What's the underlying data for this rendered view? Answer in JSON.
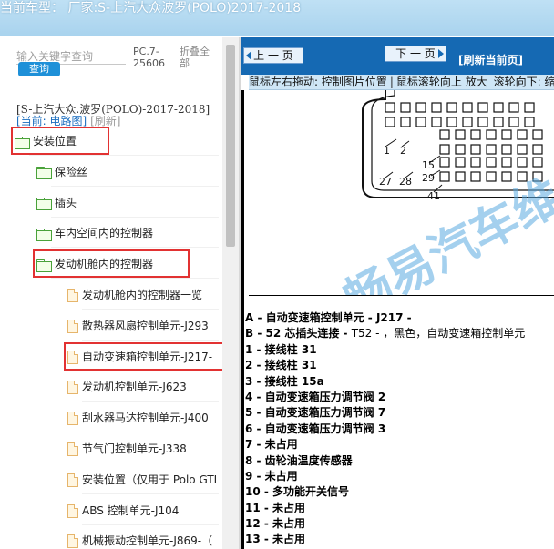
{
  "titlebar": {
    "text": "当前车型：  厂家:S-上汽大众波罗(POLO)2017-2018"
  },
  "left": {
    "search_placeholder": "输入关键字查询",
    "query_label": "查询",
    "pc_label": "PC.7-25606",
    "collapse_label": "折叠全部",
    "car_model": "[S-上汽大众.波罗(POLO)-2017-2018]",
    "current_prefix": "[当前: 电路图]",
    "refresh_label": "[刷新]",
    "tree": [
      {
        "label": "安装位置",
        "type": "folder",
        "level": 0,
        "highlighted": true
      },
      {
        "label": "保险丝",
        "type": "folder",
        "level": 1,
        "highlighted": false
      },
      {
        "label": "插头",
        "type": "folder",
        "level": 1,
        "highlighted": false
      },
      {
        "label": "车内空间内的控制器",
        "type": "folder",
        "level": 1,
        "highlighted": false
      },
      {
        "label": "发动机舱内的控制器",
        "type": "folder",
        "level": 1,
        "highlighted": true
      },
      {
        "label": "发动机舱内的控制器一览",
        "type": "doc",
        "level": 2,
        "highlighted": false
      },
      {
        "label": "散热器风扇控制单元-J293",
        "type": "doc",
        "level": 2,
        "highlighted": false
      },
      {
        "label": "自动变速箱控制单元-J217-",
        "type": "doc",
        "level": 2,
        "highlighted": true
      },
      {
        "label": "发动机控制单元-J623",
        "type": "doc",
        "level": 2,
        "highlighted": false
      },
      {
        "label": "刮水器马达控制单元-J400",
        "type": "doc",
        "level": 2,
        "highlighted": false
      },
      {
        "label": "节气门控制单元-J338",
        "type": "doc",
        "level": 2,
        "highlighted": false
      },
      {
        "label": "安装位置（仅用于 Polo GTI",
        "type": "doc",
        "level": 2,
        "highlighted": false
      },
      {
        "label": "ABS 控制单元-J104",
        "type": "doc",
        "level": 2,
        "highlighted": false
      },
      {
        "label": "机械振动控制单元-J869-（",
        "type": "doc",
        "level": 2,
        "highlighted": false
      }
    ]
  },
  "right": {
    "prev_label": "上 一 页",
    "next_label": "下 一 页",
    "refresh_page_label": "[刷新当前页]",
    "hint_1": "鼠标左右拖动: 控制图片位置",
    "hint_2": "鼠标滚轮向上 放大",
    "hint_3": "滚轮向下: 缩",
    "watermark": "畅易汽车维修",
    "pin_labels": [
      "1",
      "2",
      "15",
      "27",
      "28",
      "29",
      "41"
    ],
    "legend": [
      {
        "text": "A - 自动变速箱控制单元 - J217 -",
        "extra": ""
      },
      {
        "text": "B - 52 芯插头连接 - ",
        "extra": "T52 - ，黑色，自动变速箱控制单元"
      },
      {
        "text": "1 - 接线柱 31",
        "extra": ""
      },
      {
        "text": "2 - 接线柱 31",
        "extra": ""
      },
      {
        "text": "3 - 接线柱 15a",
        "extra": ""
      },
      {
        "text": "4 - 自动变速箱压力调节阀 2",
        "extra": ""
      },
      {
        "text": "5 - 自动变速箱压力调节阀 7",
        "extra": ""
      },
      {
        "text": "6 - 自动变速箱压力调节阀 3",
        "extra": ""
      },
      {
        "text": "7 - 未占用",
        "extra": ""
      },
      {
        "text": "8 - 齿轮油温度传感器",
        "extra": ""
      },
      {
        "text": "9 - 未占用",
        "extra": ""
      },
      {
        "text": "10 - 多功能开关信号",
        "extra": ""
      },
      {
        "text": "11 - 未占用",
        "extra": ""
      },
      {
        "text": "12 - 未占用",
        "extra": ""
      },
      {
        "text": "13 - 未占用",
        "extra": ""
      }
    ]
  }
}
